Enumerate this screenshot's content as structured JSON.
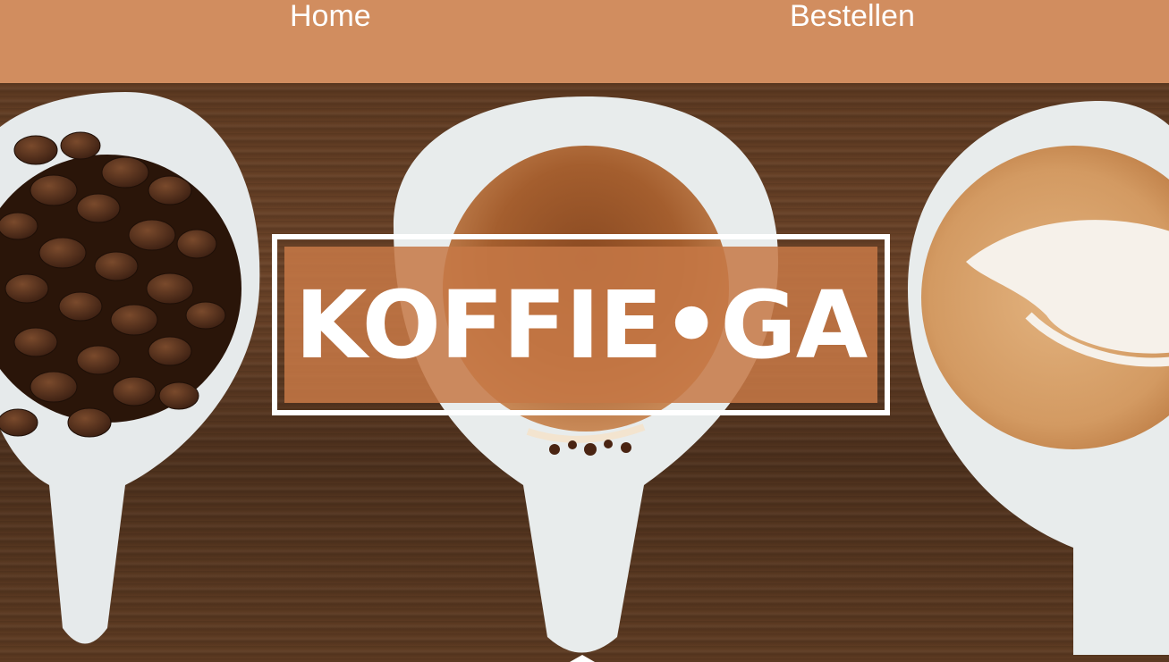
{
  "nav": {
    "home_label": "Home",
    "order_label": "Bestellen"
  },
  "brand": {
    "logo_text": "KOFFIE•GA"
  },
  "colors": {
    "nav_background": "#d18d5f",
    "logo_fill": "#c67846",
    "text": "#ffffff"
  },
  "hero": {
    "image_description_icons": [
      "coffee-beans-cup-icon",
      "espresso-cup-icon",
      "latte-cup-icon"
    ]
  }
}
